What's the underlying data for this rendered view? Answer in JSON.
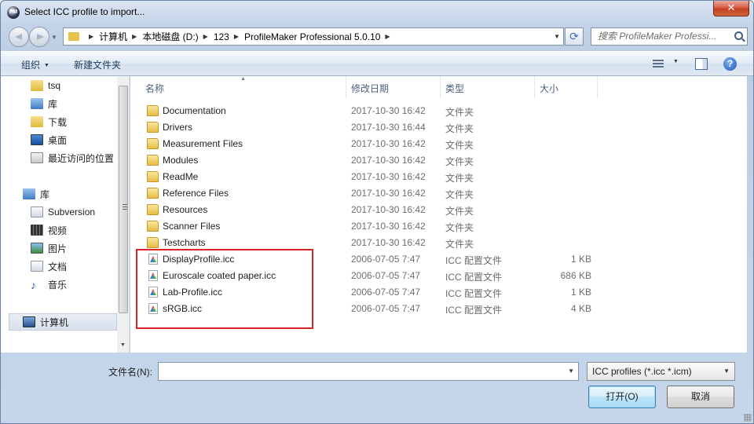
{
  "window": {
    "title": "Select ICC profile to import..."
  },
  "address": {
    "crumbs": [
      "计算机",
      "本地磁盘 (D:)",
      "123",
      "ProfileMaker Professional 5.0.10"
    ],
    "search_placeholder": "搜索 ProfileMaker Professi..."
  },
  "toolbar": {
    "organize": "组织",
    "new_folder": "新建文件夹",
    "help": "?"
  },
  "nav": {
    "favorites": [
      {
        "label": "tsq",
        "icon": "folder-icon"
      },
      {
        "label": "库",
        "icon": "library-icon"
      },
      {
        "label": "下载",
        "icon": "downloads-icon"
      },
      {
        "label": "桌面",
        "icon": "desktop-icon"
      },
      {
        "label": "最近访问的位置",
        "icon": "recent-places-icon"
      }
    ],
    "library_group": "库",
    "libraries": [
      {
        "label": "Subversion",
        "icon": "document-icon"
      },
      {
        "label": "视频",
        "icon": "video-icon"
      },
      {
        "label": "图片",
        "icon": "picture-icon"
      },
      {
        "label": "文档",
        "icon": "document-icon"
      },
      {
        "label": "音乐",
        "icon": "music-icon"
      }
    ],
    "computer": "计算机"
  },
  "columns": {
    "name": "名称",
    "date": "修改日期",
    "type": "类型",
    "size": "大小"
  },
  "files": [
    {
      "name": "Documentation",
      "date": "2017-10-30 16:42",
      "type": "文件夹",
      "size": "",
      "kind": "folder"
    },
    {
      "name": "Drivers",
      "date": "2017-10-30 16:44",
      "type": "文件夹",
      "size": "",
      "kind": "folder"
    },
    {
      "name": "Measurement Files",
      "date": "2017-10-30 16:42",
      "type": "文件夹",
      "size": "",
      "kind": "folder"
    },
    {
      "name": "Modules",
      "date": "2017-10-30 16:42",
      "type": "文件夹",
      "size": "",
      "kind": "folder"
    },
    {
      "name": "ReadMe",
      "date": "2017-10-30 16:42",
      "type": "文件夹",
      "size": "",
      "kind": "folder"
    },
    {
      "name": "Reference Files",
      "date": "2017-10-30 16:42",
      "type": "文件夹",
      "size": "",
      "kind": "folder"
    },
    {
      "name": "Resources",
      "date": "2017-10-30 16:42",
      "type": "文件夹",
      "size": "",
      "kind": "folder"
    },
    {
      "name": "Scanner Files",
      "date": "2017-10-30 16:42",
      "type": "文件夹",
      "size": "",
      "kind": "folder"
    },
    {
      "name": "Testcharts",
      "date": "2017-10-30 16:42",
      "type": "文件夹",
      "size": "",
      "kind": "folder"
    },
    {
      "name": "DisplayProfile.icc",
      "date": "2006-07-05 7:47",
      "type": "ICC 配置文件",
      "size": "1 KB",
      "kind": "icc"
    },
    {
      "name": "Euroscale coated paper.icc",
      "date": "2006-07-05 7:47",
      "type": "ICC 配置文件",
      "size": "686 KB",
      "kind": "icc"
    },
    {
      "name": "Lab-Profile.icc",
      "date": "2006-07-05 7:47",
      "type": "ICC 配置文件",
      "size": "1 KB",
      "kind": "icc"
    },
    {
      "name": "sRGB.icc",
      "date": "2006-07-05 7:47",
      "type": "ICC 配置文件",
      "size": "4 KB",
      "kind": "icc"
    }
  ],
  "footer": {
    "filename_label": "文件名(N):",
    "filename_value": "",
    "filter": "ICC profiles (*.icc *.icm)",
    "open": "打开(O)",
    "cancel": "取消"
  },
  "colors": {
    "highlight": "#d9262c",
    "accent": "#3c7fb1"
  }
}
